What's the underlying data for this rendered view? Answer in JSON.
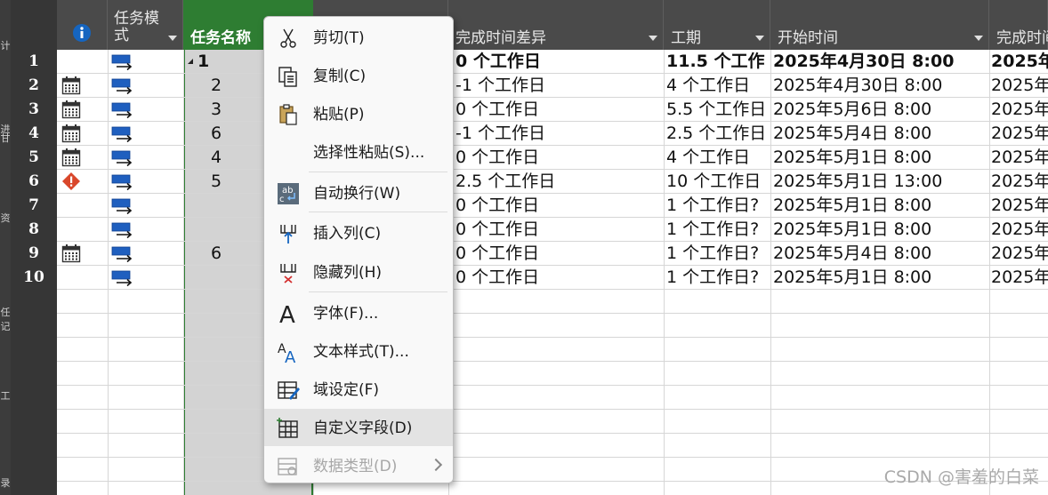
{
  "left_strip": [
    "计",
    "进",
    "甘",
    "资",
    "任",
    "记",
    "工",
    "录"
  ],
  "columns": [
    {
      "key": "info",
      "label": "",
      "icon": "info-icon"
    },
    {
      "key": "mode",
      "label": "任务模式"
    },
    {
      "key": "name",
      "label": "任务名称"
    },
    {
      "key": "hidden",
      "label": ""
    },
    {
      "key": "finish_var",
      "label": "完成时间差异"
    },
    {
      "key": "duration",
      "label": "工期"
    },
    {
      "key": "start",
      "label": "开始时间"
    },
    {
      "key": "finish",
      "label": "完成时间"
    }
  ],
  "rows": [
    {
      "num": "1",
      "indicator": "none",
      "name": "1",
      "finish_var": "0 个工作日",
      "duration": "11.5 个工作",
      "start": "2025年4月30日 8:00",
      "finish": "2025年",
      "summary": true
    },
    {
      "num": "2",
      "indicator": "calendar",
      "name": "2",
      "finish_var": "-1 个工作日",
      "duration": "4 个工作日",
      "start": "2025年4月30日 8:00",
      "finish": "2025年"
    },
    {
      "num": "3",
      "indicator": "calendar",
      "name": "3",
      "finish_var": "0 个工作日",
      "duration": "5.5 个工作日",
      "start": "2025年5月6日 8:00",
      "finish": "2025年"
    },
    {
      "num": "4",
      "indicator": "calendar",
      "name": "6",
      "finish_var": "-1 个工作日",
      "duration": "2.5 个工作日",
      "start": "2025年5月4日 8:00",
      "finish": "2025年"
    },
    {
      "num": "5",
      "indicator": "calendar",
      "name": "4",
      "finish_var": "0 个工作日",
      "duration": "4 个工作日",
      "start": "2025年5月1日 8:00",
      "finish": "2025年"
    },
    {
      "num": "6",
      "indicator": "warning",
      "name": "5",
      "finish_var": "2.5 个工作日",
      "duration": "10 个工作日",
      "start": "2025年5月1日 13:00",
      "finish": "2025年"
    },
    {
      "num": "7",
      "indicator": "none",
      "name": "",
      "finish_var": "0 个工作日",
      "duration": "1 个工作日?",
      "start": "2025年5月1日 8:00",
      "finish": "2025年"
    },
    {
      "num": "8",
      "indicator": "none",
      "name": "",
      "finish_var": "0 个工作日",
      "duration": "1 个工作日?",
      "start": "2025年5月1日 8:00",
      "finish": "2025年"
    },
    {
      "num": "9",
      "indicator": "calendar",
      "name": "6",
      "finish_var": "0 个工作日",
      "duration": "1 个工作日?",
      "start": "2025年5月4日 8:00",
      "finish": "2025年"
    },
    {
      "num": "10",
      "indicator": "none",
      "name": "",
      "finish_var": "0 个工作日",
      "duration": "1 个工作日?",
      "start": "2025年5月1日 8:00",
      "finish": "2025年"
    }
  ],
  "context_menu": [
    {
      "id": "cut",
      "label": "剪切(T)",
      "icon": "scissors-icon"
    },
    {
      "id": "copy",
      "label": "复制(C)",
      "icon": "copy-icon"
    },
    {
      "id": "paste",
      "label": "粘贴(P)",
      "icon": "clipboard-icon"
    },
    {
      "id": "paste_special",
      "label": "选择性粘贴(S)...",
      "icon": ""
    },
    {
      "id": "wrap",
      "label": "自动换行(W)",
      "icon": "wrap-text-icon"
    },
    {
      "id": "insert_col",
      "label": "插入列(C)",
      "icon": "insert-column-icon"
    },
    {
      "id": "hide_col",
      "label": "隐藏列(H)",
      "icon": "hide-column-icon"
    },
    {
      "id": "font",
      "label": "字体(F)...",
      "icon": "font-icon"
    },
    {
      "id": "text_style",
      "label": "文本样式(T)...",
      "icon": "text-style-icon"
    },
    {
      "id": "field_settings",
      "label": "域设定(F)",
      "icon": "field-settings-icon"
    },
    {
      "id": "custom_fields",
      "label": "自定义字段(D)",
      "icon": "custom-field-icon",
      "highlighted": true
    },
    {
      "id": "data_type",
      "label": "数据类型(D)",
      "icon": "data-type-icon",
      "disabled": true,
      "submenu": true
    }
  ],
  "watermark": "CSDN @害羞的白菜",
  "colors": {
    "selection_border": "#2e7d32",
    "header_bg": "#4a4a4a",
    "rownum_bg": "#363636",
    "warning": "#d9472b",
    "mode_icon": "#1f5fbf"
  }
}
